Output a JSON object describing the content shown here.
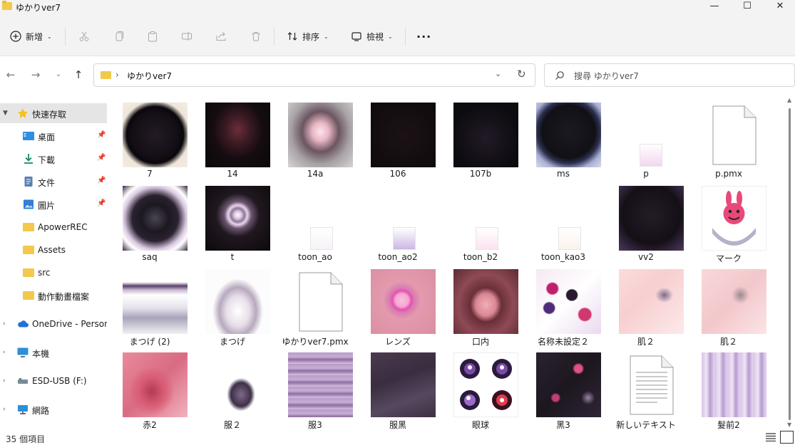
{
  "window": {
    "title": "ゆかりver7"
  },
  "toolbar": {
    "new_label": "新增",
    "sort_label": "排序",
    "view_label": "檢視"
  },
  "address": {
    "path_segment": "ゆかりver7"
  },
  "search": {
    "placeholder": "搜尋 ゆかりver7"
  },
  "sidebar": {
    "quick_access": "快速存取",
    "items": [
      {
        "label": "桌面",
        "icon": "desktop-icon"
      },
      {
        "label": "下載",
        "icon": "download-icon"
      },
      {
        "label": "文件",
        "icon": "documents-icon"
      },
      {
        "label": "圖片",
        "icon": "pictures-icon"
      },
      {
        "label": "ApowerREC",
        "icon": "folder-icon"
      },
      {
        "label": "Assets",
        "icon": "folder-icon"
      },
      {
        "label": "src",
        "icon": "folder-icon"
      },
      {
        "label": "動作動畫檔案",
        "icon": "folder-icon"
      }
    ],
    "onedrive": "OneDrive - Persona",
    "this_pc": "本機",
    "usb": "ESD-USB (F:)",
    "network": "網路"
  },
  "files": [
    {
      "name": "7"
    },
    {
      "name": "14"
    },
    {
      "name": "14a"
    },
    {
      "name": "106"
    },
    {
      "name": "107b"
    },
    {
      "name": "ms"
    },
    {
      "name": "p"
    },
    {
      "name": "p.pmx"
    },
    {
      "name": "saq"
    },
    {
      "name": "t"
    },
    {
      "name": "toon_ao"
    },
    {
      "name": "toon_ao2"
    },
    {
      "name": "toon_b2"
    },
    {
      "name": "toon_kao3"
    },
    {
      "name": "vv2"
    },
    {
      "name": "マーク"
    },
    {
      "name": "まつげ (2)"
    },
    {
      "name": "まつげ"
    },
    {
      "name": "ゆかりver7.pmx"
    },
    {
      "name": "レンズ"
    },
    {
      "name": "口内"
    },
    {
      "name": "名称未設定２"
    },
    {
      "name": "肌２"
    },
    {
      "name": "肌２"
    },
    {
      "name": "赤2"
    },
    {
      "name": "服２"
    },
    {
      "name": "服3"
    },
    {
      "name": "服黑"
    },
    {
      "name": "眼球"
    },
    {
      "name": "黑3"
    },
    {
      "name": "新しいテキスト"
    },
    {
      "name": "髮前2"
    }
  ],
  "status": {
    "count": "35 個項目"
  },
  "colors": {
    "accent": "#0067c0",
    "selected_bg": "#e5e5e5",
    "folder": "#f2c94c"
  }
}
